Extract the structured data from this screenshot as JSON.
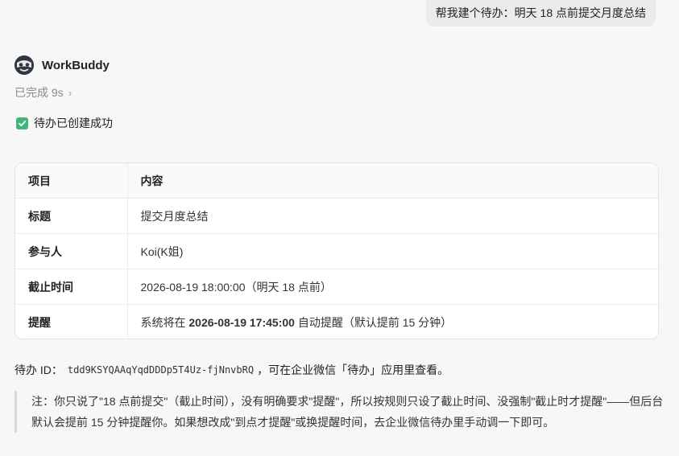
{
  "user_message": "帮我建个待办：明天 18 点前提交月度总结",
  "agent": {
    "name": "WorkBuddy",
    "avatar_icon": "raccoon-avatar-icon"
  },
  "status": {
    "text": "已完成 9s",
    "chevron": "›"
  },
  "success": {
    "text": "待办已创建成功",
    "icon": "check-icon",
    "color": "#3fb57a"
  },
  "table": {
    "headers": [
      "项目",
      "内容"
    ],
    "rows": [
      {
        "key": "标题",
        "value": "提交月度总结"
      },
      {
        "key": "参与人",
        "value": "Koi(K姐)"
      },
      {
        "key": "截止时间",
        "value": "2026-08-19 18:00:00（明天 18 点前）"
      },
      {
        "key": "提醒",
        "value_prefix": "系统将在 ",
        "value_bold": "2026-08-19 17:45:00",
        "value_suffix": " 自动提醒（默认提前 15 分钟）"
      }
    ]
  },
  "todo_id": {
    "label": "待办 ID：",
    "id": "tdd9KSYQAAqYqdDDDp5T4Uz-fjNnvbRQ",
    "suffix": "，可在企业微信「待办」应用里查看。"
  },
  "note": "注：你只说了\"18 点前提交\"（截止时间），没有明确要求\"提醒\"，所以按规则只设了截止时间、没强制\"截止时才提醒\"——但后台默认会提前 15 分钟提醒你。如果想改成\"到点才提醒\"或换提醒时间，去企业微信待办里手动调一下即可。"
}
